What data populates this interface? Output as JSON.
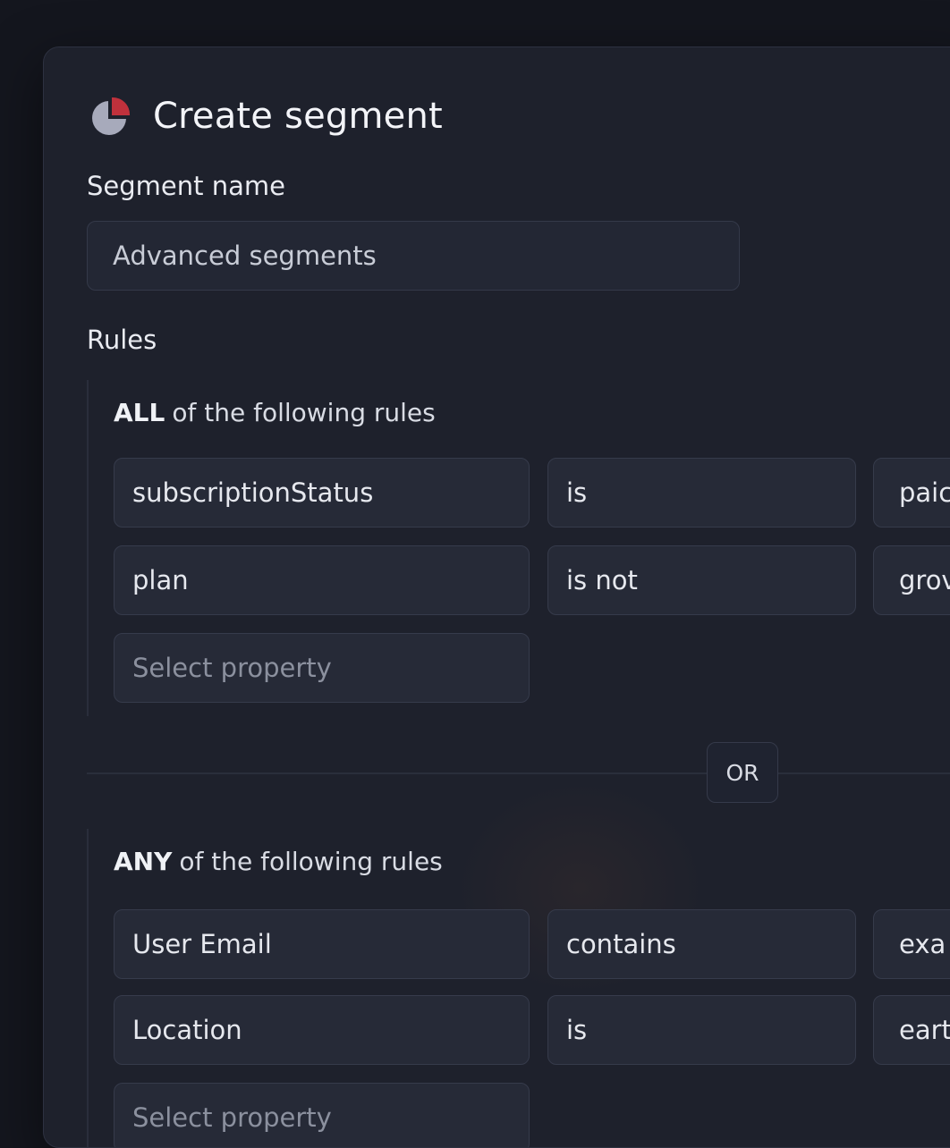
{
  "header": {
    "title": "Create segment",
    "icon": "pie-chart-icon",
    "icon_colors": {
      "base": "#a7aabb",
      "accent": "#c0313c"
    }
  },
  "segment_name": {
    "label": "Segment name",
    "value": "Advanced segments"
  },
  "rules": {
    "label": "Rules",
    "groups": [
      {
        "quantifier": "ALL",
        "suffix": "of the following rules",
        "rows": [
          {
            "property": "subscriptionStatus",
            "operator": "is",
            "value": "paic"
          },
          {
            "property": "plan",
            "operator": "is not",
            "value": "grov"
          }
        ],
        "add_placeholder": "Select property"
      },
      {
        "quantifier": "ANY",
        "suffix": "of the following rules",
        "rows": [
          {
            "property": "User Email",
            "operator": "contains",
            "value": "exa"
          },
          {
            "property": "Location",
            "operator": "is",
            "value": "eart"
          }
        ],
        "add_placeholder": "Select property"
      }
    ],
    "joiner": "OR"
  }
}
